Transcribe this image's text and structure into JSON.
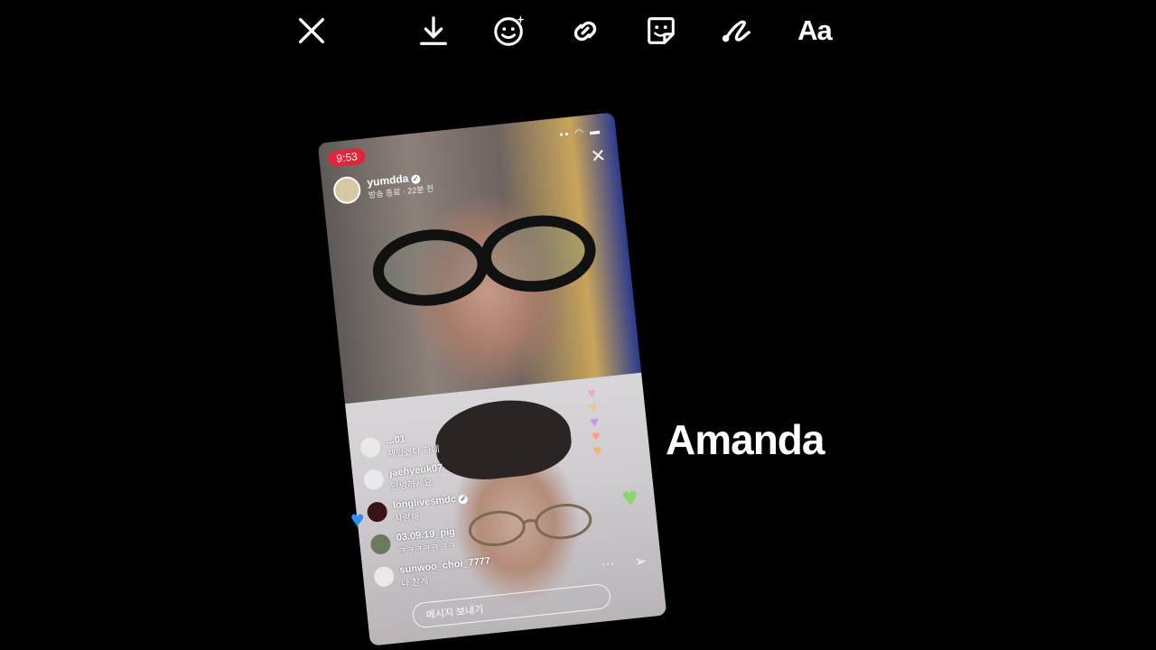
{
  "toolbar": {
    "items": [
      {
        "name": "close",
        "icon": "close-icon"
      },
      {
        "name": "download",
        "icon": "download-icon"
      },
      {
        "name": "effects",
        "icon": "face-sparkle-icon"
      },
      {
        "name": "link",
        "icon": "link-icon"
      },
      {
        "name": "sticker",
        "icon": "sticker-icon"
      },
      {
        "name": "draw",
        "icon": "draw-icon"
      },
      {
        "name": "text",
        "label": "Aa"
      }
    ]
  },
  "story": {
    "time": "9:53",
    "host": {
      "username": "yumdda",
      "subtitle": "방송 종료 · 22분 전"
    },
    "comments": [
      {
        "user": "...01",
        "text": "재밌겠다 하네"
      },
      {
        "user": "jaehyeuk07",
        "text": "안녕하세요"
      },
      {
        "user": "longlivesmdc",
        "text": "사랑해"
      },
      {
        "user": "03.09.19_pig",
        "text": "ㅋㅋㅋㅋㅋㅋㅋ"
      },
      {
        "user": "sunwoo_choi_7777",
        "text": "나 참게"
      }
    ],
    "message_placeholder": "메시지 보내기"
  },
  "overlay_text": "Amanda",
  "colors": {
    "background": "#000000",
    "live_red": "#e0263a",
    "blue_heart": "#2f8bff"
  }
}
